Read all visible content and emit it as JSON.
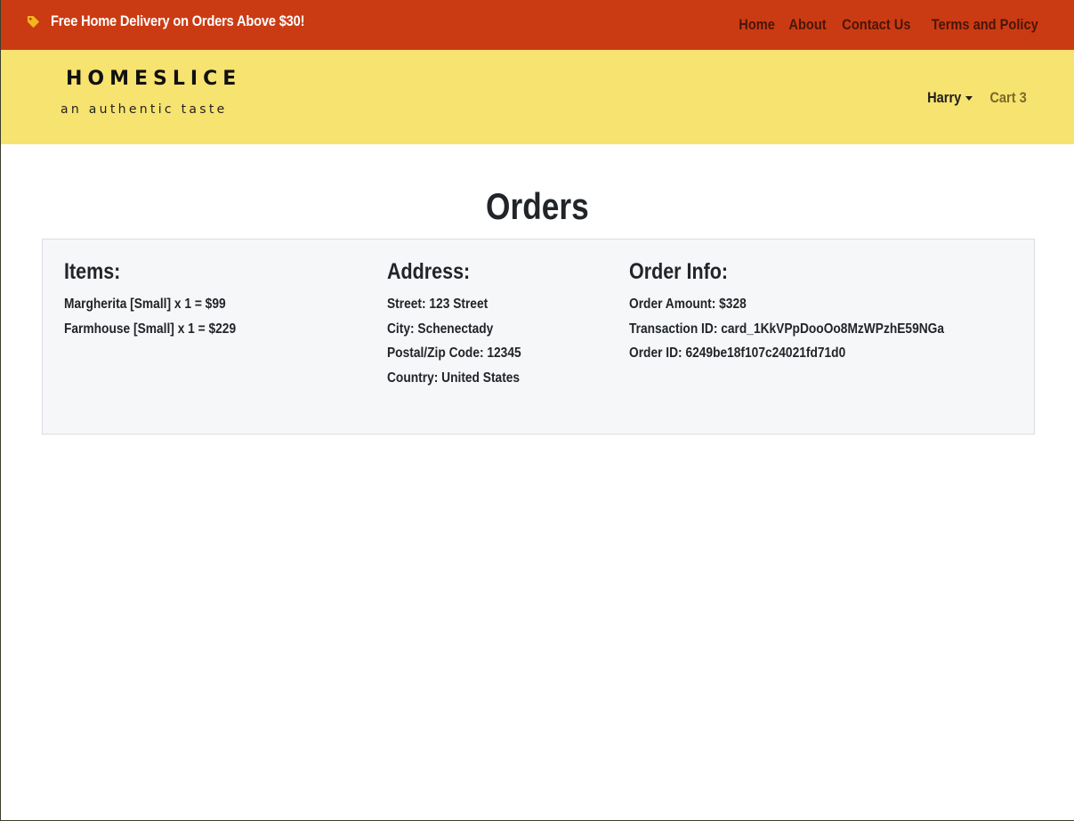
{
  "topbar": {
    "promo_text": "Free Home Delivery on Orders Above $30!",
    "icon": "tag-icon",
    "nav": [
      {
        "label": "Home"
      },
      {
        "label": "About"
      },
      {
        "label": "Contact Us"
      },
      {
        "label": "Terms and Policy"
      }
    ]
  },
  "header": {
    "logo_title": "HOMESLICE",
    "logo_subtitle": "an authentic taste",
    "user_name": "Harry",
    "cart_label": "Cart 3"
  },
  "main": {
    "title": "Orders",
    "order": {
      "items_heading": "Items:",
      "items": [
        "Margherita [Small] x 1 = $99",
        "Farmhouse [Small] x 1 = $229"
      ],
      "address_heading": "Address:",
      "address": {
        "street": "Street: 123 Street",
        "city": "City: Schenectady",
        "postal": "Postal/Zip Code: 12345",
        "country": "Country: United States"
      },
      "info_heading": "Order Info:",
      "info": {
        "amount": "Order Amount: $328",
        "transaction": "Transaction ID: card_1KkVPpDooOo8MzWPzhE59NGa",
        "order_id": "Order ID: 6249be18f107c24021fd71d0"
      }
    }
  },
  "colors": {
    "topbar": "#cb3b13",
    "header": "#f7e36f",
    "card": "#f6f7f9",
    "tag_icon": "#f3b61f"
  }
}
